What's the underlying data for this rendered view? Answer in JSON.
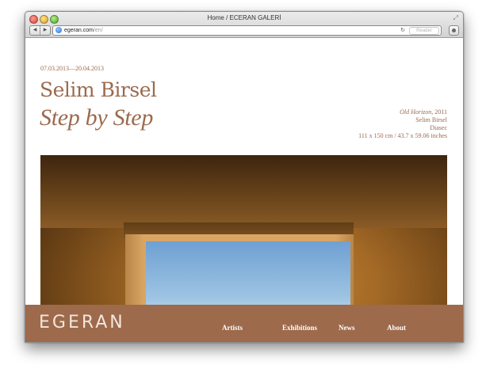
{
  "browser": {
    "window_title": "Home / ECERAN GALERİ",
    "url_domain": "egeran.com",
    "url_path": "/en/",
    "reader_label": "Reader"
  },
  "exhibition": {
    "dates": "07.03.2013—20.04.2013",
    "artist": "Selim Birsel",
    "title": "Step by Step",
    "caption": {
      "work_title": "Old Horizon",
      "year": ", 2011",
      "artist": "Selim Birsel",
      "medium": "Diasec",
      "dimensions": "111 x 150 cm / 43.7 x 59.06 inches"
    }
  },
  "footer": {
    "logo": "EGERAN",
    "nav": [
      "Artists",
      "Exhibitions",
      "News",
      "About"
    ]
  },
  "colors": {
    "accent": "#9b6a4e",
    "footer_bg": "#9d6a4b"
  }
}
